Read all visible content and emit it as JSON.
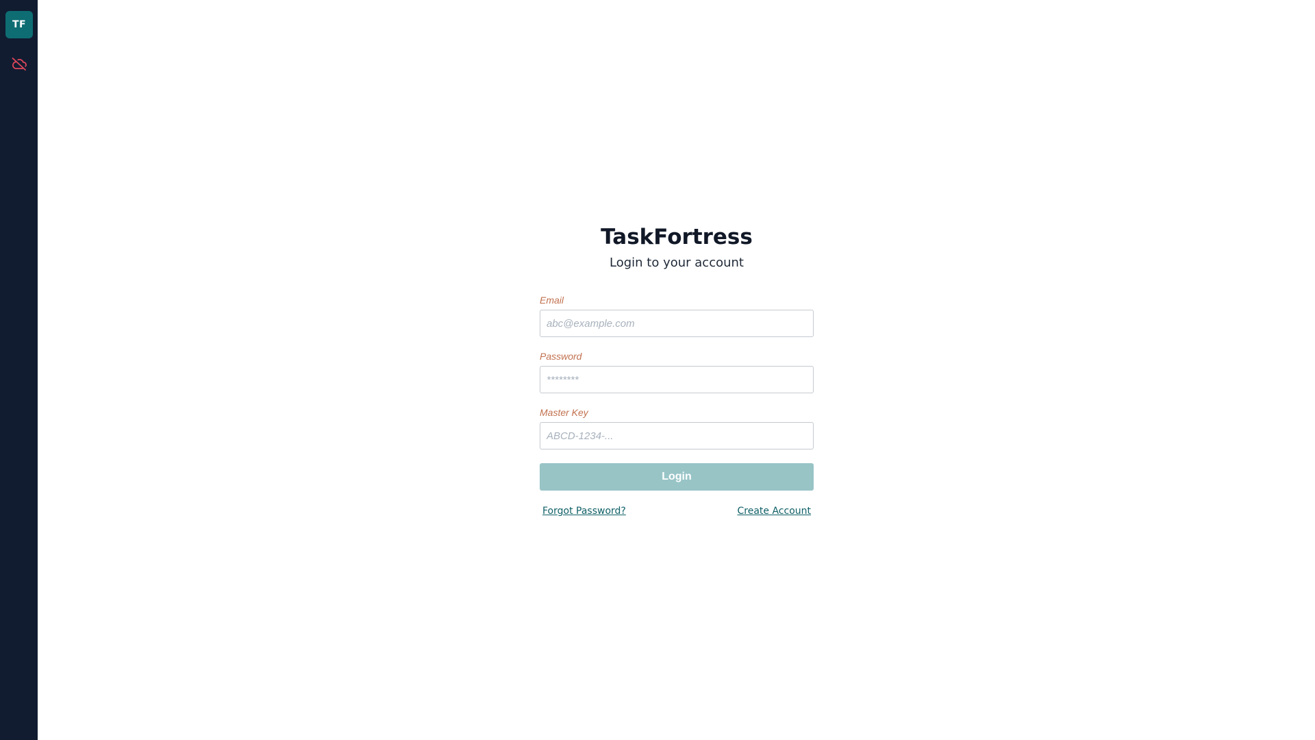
{
  "sidebar": {
    "brand_initials": "TF",
    "brand_color": "#0e6d73",
    "background_color": "#111c31",
    "sync_status": {
      "icon": "cloud-off-icon",
      "color": "#e0475b"
    }
  },
  "login": {
    "title": "TaskFortress",
    "subtitle": "Login to your account",
    "fields": {
      "email": {
        "label": "Email",
        "placeholder": "abc@example.com",
        "value": ""
      },
      "password": {
        "label": "Password",
        "placeholder": "********",
        "value": ""
      },
      "master_key": {
        "label": "Master Key",
        "placeholder": "ABCD-1234-...",
        "value": ""
      }
    },
    "submit_label": "Login",
    "forgot_password_label": "Forgot Password?",
    "create_account_label": "Create Account",
    "label_color": "#c2714f",
    "button_color": "#98c4c6",
    "link_color": "#0e5f66"
  }
}
